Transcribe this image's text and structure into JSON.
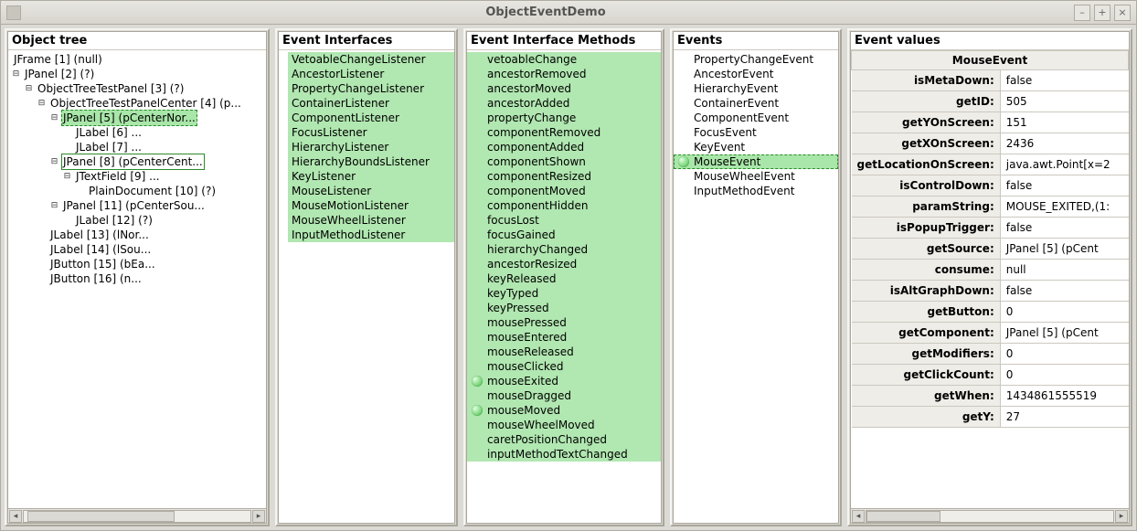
{
  "window": {
    "title": "ObjectEventDemo"
  },
  "panels": {
    "tree": "Object tree",
    "ifaces": "Event Interfaces",
    "methods": "Event Interface Methods",
    "events": "Events",
    "values": "Event values"
  },
  "tree": {
    "n0": "JFrame [1]  (null)",
    "n1": "JPanel [2]  (?)",
    "n2": "ObjectTreeTestPanel [3]  (?)",
    "n3": "ObjectTreeTestPanelCenter [4]  (p...",
    "n4": "JPanel [5]  (pCenterNor...",
    "n5": "JLabel [6]  ...",
    "n6": "JLabel [7]  ...",
    "n7": "JPanel [8]  (pCenterCent...",
    "n8": "JTextField [9]  ...",
    "n9": "PlainDocument [10]  (?)",
    "n10": "JPanel [11]  (pCenterSou...",
    "n11": "JLabel [12]  (?)",
    "n12": "JLabel [13]  (lNor...",
    "n13": "JLabel [14]  (lSou...",
    "n14": "JButton [15]  (bEa...",
    "n15": "JButton [16]  (n..."
  },
  "ifaces": [
    "VetoableChangeListener",
    "AncestorListener",
    "PropertyChangeListener",
    "ContainerListener",
    "ComponentListener",
    "FocusListener",
    "HierarchyListener",
    "HierarchyBoundsListener",
    "KeyListener",
    "MouseListener",
    "MouseMotionListener",
    "MouseWheelListener",
    "InputMethodListener"
  ],
  "methods": [
    {
      "label": "vetoableChange",
      "dot": false
    },
    {
      "label": "ancestorRemoved",
      "dot": false
    },
    {
      "label": "ancestorMoved",
      "dot": false
    },
    {
      "label": "ancestorAdded",
      "dot": false
    },
    {
      "label": "propertyChange",
      "dot": false
    },
    {
      "label": "componentRemoved",
      "dot": false
    },
    {
      "label": "componentAdded",
      "dot": false
    },
    {
      "label": "componentShown",
      "dot": false
    },
    {
      "label": "componentResized",
      "dot": false
    },
    {
      "label": "componentMoved",
      "dot": false
    },
    {
      "label": "componentHidden",
      "dot": false
    },
    {
      "label": "focusLost",
      "dot": false
    },
    {
      "label": "focusGained",
      "dot": false
    },
    {
      "label": "hierarchyChanged",
      "dot": false
    },
    {
      "label": "ancestorResized",
      "dot": false
    },
    {
      "label": "keyReleased",
      "dot": false
    },
    {
      "label": "keyTyped",
      "dot": false
    },
    {
      "label": "keyPressed",
      "dot": false
    },
    {
      "label": "mousePressed",
      "dot": false
    },
    {
      "label": "mouseEntered",
      "dot": false
    },
    {
      "label": "mouseReleased",
      "dot": false
    },
    {
      "label": "mouseClicked",
      "dot": false
    },
    {
      "label": "mouseExited",
      "dot": true
    },
    {
      "label": "mouseDragged",
      "dot": false
    },
    {
      "label": "mouseMoved",
      "dot": true
    },
    {
      "label": "mouseWheelMoved",
      "dot": false
    },
    {
      "label": "caretPositionChanged",
      "dot": false
    },
    {
      "label": "inputMethodTextChanged",
      "dot": false
    }
  ],
  "events": [
    {
      "label": "PropertyChangeEvent",
      "dot": false,
      "sel": false
    },
    {
      "label": "AncestorEvent",
      "dot": false,
      "sel": false
    },
    {
      "label": "HierarchyEvent",
      "dot": false,
      "sel": false
    },
    {
      "label": "ContainerEvent",
      "dot": false,
      "sel": false
    },
    {
      "label": "ComponentEvent",
      "dot": false,
      "sel": false
    },
    {
      "label": "FocusEvent",
      "dot": false,
      "sel": false
    },
    {
      "label": "KeyEvent",
      "dot": false,
      "sel": false
    },
    {
      "label": "MouseEvent",
      "dot": true,
      "sel": true
    },
    {
      "label": "MouseWheelEvent",
      "dot": false,
      "sel": false
    },
    {
      "label": "InputMethodEvent",
      "dot": false,
      "sel": false
    }
  ],
  "values": {
    "header": "MouseEvent",
    "rows": [
      {
        "k": "isMetaDown:",
        "v": "false"
      },
      {
        "k": "getID:",
        "v": "505"
      },
      {
        "k": "getYOnScreen:",
        "v": "151"
      },
      {
        "k": "getXOnScreen:",
        "v": "2436"
      },
      {
        "k": "getLocationOnScreen:",
        "v": "java.awt.Point[x=2"
      },
      {
        "k": "isControlDown:",
        "v": "false"
      },
      {
        "k": "paramString:",
        "v": "MOUSE_EXITED,(1:"
      },
      {
        "k": "isPopupTrigger:",
        "v": "false"
      },
      {
        "k": "getSource:",
        "v": "JPanel [5]  (pCent"
      },
      {
        "k": "consume:",
        "v": "null"
      },
      {
        "k": "isAltGraphDown:",
        "v": "false"
      },
      {
        "k": "getButton:",
        "v": "0"
      },
      {
        "k": "getComponent:",
        "v": "JPanel [5]  (pCent"
      },
      {
        "k": "getModifiers:",
        "v": "0"
      },
      {
        "k": "getClickCount:",
        "v": "0"
      },
      {
        "k": "getWhen:",
        "v": "1434861555519"
      },
      {
        "k": "getY:",
        "v": "27"
      }
    ]
  }
}
